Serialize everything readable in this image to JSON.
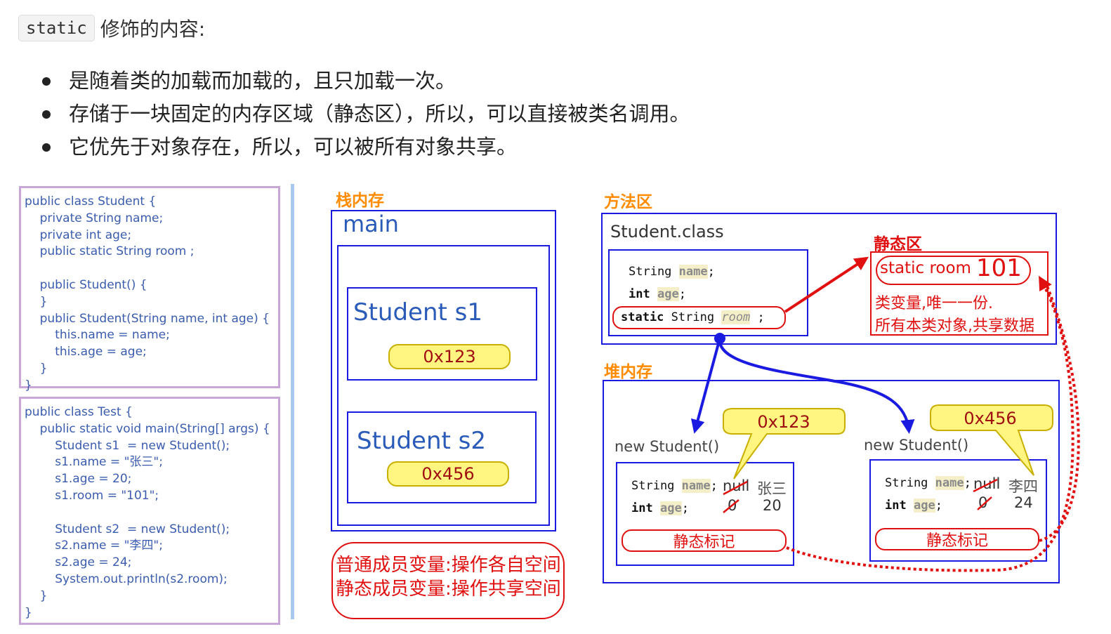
{
  "heading": {
    "code": "static",
    "text": "修饰的内容:"
  },
  "bullets": [
    "是随着类的加载而加载的，且只加载一次。",
    "存储于一块固定的内存区域（静态区），所以，可以直接被类名调用。",
    "它优先于对象存在，所以，可以被所有对象共享。"
  ],
  "code_student": "public class Student {\n    private String name;\n    private int age;\n    public static String room ;\n\n    public Student() {\n    }\n    public Student(String name, int age) {\n        this.name = name;\n        this.age = age;\n    }\n}",
  "code_test": "public class Test {\n    public static void main(String[] args) {\n        Student s1  = new Student();\n        s1.name = \"张三\";\n        s1.age = 20;\n        s1.room = \"101\";\n\n        Student s2  = new Student();\n        s2.name = \"李四\";\n        s2.age = 24;\n        System.out.println(s2.room);\n    }\n}",
  "stack": {
    "title": "栈内存",
    "frame": "main",
    "s1_label": "Student s1",
    "s1_addr": "0x123",
    "s2_label": "Student s2",
    "s2_addr": "0x456",
    "note_line1": "普通成员变量:操作各自空间",
    "note_line2": "静态成员变量:操作共享空间"
  },
  "method_area": {
    "title": "方法区",
    "class_name": "Student.class",
    "field1_type": "String",
    "field1_name": "name",
    "field2_type": "int",
    "field2_name": "age",
    "field3_mod": "static",
    "field3_type": "String",
    "field3_name": "room",
    "static_area_title": "静态区",
    "static_room_label": "static room",
    "static_room_value": "101",
    "static_desc1": "类变量,唯一一份.",
    "static_desc2": "所有本类对象,共享数据"
  },
  "heap": {
    "title": "堆内存",
    "obj1": {
      "label": "new Student()",
      "addr": "0x123",
      "name_type": "String",
      "name_field": "name",
      "old_name": "null",
      "new_name": "张三",
      "age_type": "int",
      "age_field": "age",
      "old_age": "0",
      "new_age": "20",
      "static_flag": "静态标记"
    },
    "obj2": {
      "label": "new Student()",
      "addr": "0x456",
      "name_type": "String",
      "name_field": "name",
      "old_name": "null",
      "new_name": "李四",
      "age_type": "int",
      "age_field": "age",
      "old_age": "0",
      "new_age": "24",
      "static_flag": "静态标记"
    }
  },
  "colors": {
    "blue_border": "#1a1ae0",
    "red": "#e01010",
    "orange_title": "#ff8c00",
    "yellow": "#fff580",
    "code_text": "#3b5cae",
    "code_border": "#c9a6d8"
  }
}
